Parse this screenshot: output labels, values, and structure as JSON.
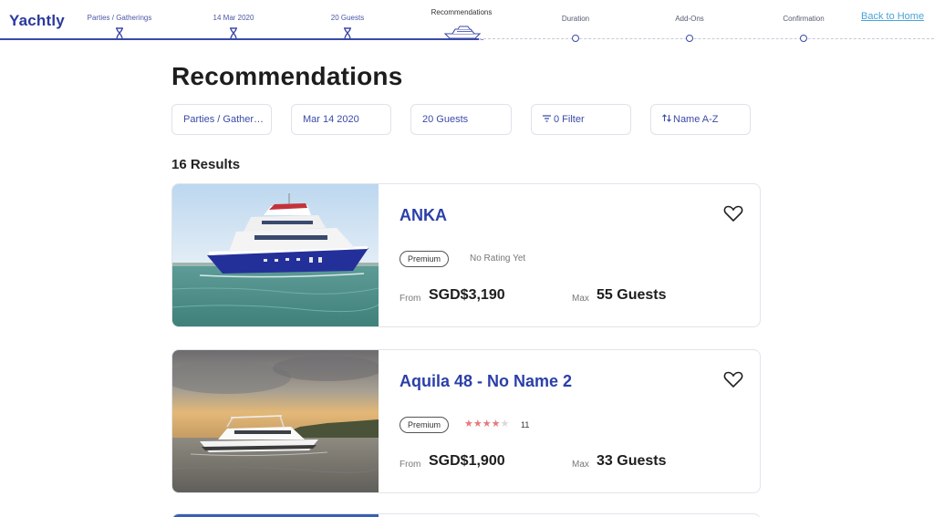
{
  "brand": {
    "logo_text": "Yachtly"
  },
  "header": {
    "back_home": "Back to Home",
    "steps": [
      {
        "label": "Parties / Gatherings",
        "state": "done"
      },
      {
        "label": "14 Mar 2020",
        "state": "done"
      },
      {
        "label": "20 Guests",
        "state": "done"
      },
      {
        "label": "Recommendations",
        "state": "current"
      },
      {
        "label": "Duration",
        "state": "future"
      },
      {
        "label": "Add-Ons",
        "state": "future"
      },
      {
        "label": "Confirmation",
        "state": "future"
      }
    ]
  },
  "main": {
    "title": "Recommendations",
    "filters": {
      "occasion": "Parties / Gather…",
      "date": "Mar 14 2020",
      "guests": "20 Guests",
      "filter": "0 Filter",
      "sort": "Name A-Z"
    },
    "results_count": "16 Results",
    "listings": [
      {
        "name": "ANKA",
        "badge": "Premium",
        "rating_text": "No Rating Yet",
        "rating_stars": null,
        "rating_count": null,
        "from_label": "From",
        "price": "SGD$3,190",
        "max_label": "Max",
        "guests": "55 Guests"
      },
      {
        "name": "Aquila 48 - No Name 2",
        "badge": "Premium",
        "rating_text": null,
        "rating_stars": 4,
        "rating_max": 5,
        "rating_count": "11",
        "from_label": "From",
        "price": "SGD$1,900",
        "max_label": "Max",
        "guests": "33 Guests"
      }
    ]
  },
  "colors": {
    "accent": "#3b4aa8",
    "title_blue": "#2b3fa8",
    "link": "#4aa3d6",
    "star": "#e8787b"
  },
  "icons": {
    "step_done": "hourglass-icon",
    "step_current": "yacht-icon",
    "step_future": "dot-icon",
    "filter": "filter-icon",
    "sort": "sort-icon",
    "favorite": "heart-icon"
  }
}
